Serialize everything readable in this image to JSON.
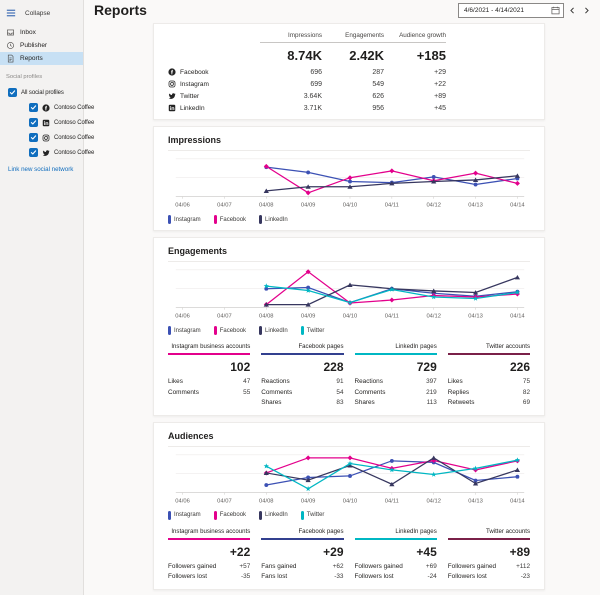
{
  "sidebar": {
    "collapse_label": "Collapse",
    "nav": [
      {
        "label": "Inbox",
        "icon": "inbox-icon",
        "key": "inbox",
        "selected": false
      },
      {
        "label": "Publisher",
        "icon": "publisher-icon",
        "key": "publisher",
        "selected": false
      },
      {
        "label": "Reports",
        "icon": "reports-icon",
        "key": "reports",
        "selected": true
      }
    ],
    "section_label": "Social profiles",
    "all_profiles_label": "All social profiles",
    "profiles": [
      {
        "network": "facebook",
        "label": "Contoso Coffee"
      },
      {
        "network": "linkedin",
        "label": "Contoso Coffee"
      },
      {
        "network": "instagram",
        "label": "Contoso Coffee"
      },
      {
        "network": "twitter",
        "label": "Contoso Coffee"
      }
    ],
    "link_label": "Link new social network"
  },
  "header": {
    "title": "Reports",
    "date_range": "4/6/2021 - 4/14/2021"
  },
  "summary": {
    "columns": [
      "Impressions",
      "Engagements",
      "Audience growth"
    ],
    "totals": [
      "8.74K",
      "2.42K",
      "+185"
    ],
    "rows": [
      {
        "network": "facebook",
        "label": "Facebook",
        "values": [
          "696",
          "287",
          "+29"
        ]
      },
      {
        "network": "instagram",
        "label": "Instagram",
        "values": [
          "699",
          "549",
          "+22"
        ]
      },
      {
        "network": "twitter",
        "label": "Twitter",
        "values": [
          "3.64K",
          "626",
          "+89"
        ]
      },
      {
        "network": "linkedin",
        "label": "LinkedIn",
        "values": [
          "3.71K",
          "956",
          "+45"
        ]
      }
    ]
  },
  "sections": {
    "impressions": {
      "title": "Impressions"
    },
    "engagements": {
      "title": "Engagements"
    },
    "audiences": {
      "title": "Audiences"
    }
  },
  "palette": {
    "instagram_line": "#3c51b4",
    "facebook_line": "#e3008c",
    "linkedin_line": "#37375f",
    "twitter_line": "#00b7c3",
    "link_blue": "#0f6cbd",
    "checkbox_blue": "#106ebe",
    "selected_nav_bg": "#c7e0f4"
  },
  "chart_data": [
    {
      "type": "line",
      "title": "Impressions",
      "x": [
        "04/06",
        "04/07",
        "04/08",
        "04/09",
        "04/10",
        "04/11",
        "04/12",
        "04/13",
        "04/14"
      ],
      "ylim": [
        0,
        100
      ],
      "grid": "horizontal",
      "legend_position": "bottom",
      "note": "values estimated 0-100 relative scale; no y-axis labels shown",
      "series": [
        {
          "name": "Instagram",
          "color": "#3c51b4",
          "marker": "circle",
          "values": [
            null,
            null,
            78,
            64,
            40,
            37,
            52,
            32,
            48
          ]
        },
        {
          "name": "Facebook",
          "color": "#e3008c",
          "marker": "diamond",
          "values": [
            null,
            null,
            80,
            10,
            50,
            68,
            42,
            62,
            35
          ]
        },
        {
          "name": "LinkedIn",
          "color": "#37375f",
          "marker": "triangle",
          "values": [
            null,
            null,
            15,
            26,
            26,
            35,
            40,
            44,
            55
          ]
        }
      ]
    },
    {
      "type": "line",
      "title": "Engagements",
      "x": [
        "04/06",
        "04/07",
        "04/08",
        "04/09",
        "04/10",
        "04/11",
        "04/12",
        "04/13",
        "04/14"
      ],
      "ylim": [
        0,
        100
      ],
      "grid": "horizontal",
      "legend_position": "bottom",
      "note": "values estimated 0-100 relative scale; no y-axis labels shown",
      "series": [
        {
          "name": "Instagram",
          "color": "#3c51b4",
          "marker": "circle",
          "values": [
            null,
            null,
            50,
            53,
            13,
            50,
            38,
            30,
            42
          ]
        },
        {
          "name": "Facebook",
          "color": "#e3008c",
          "marker": "diamond",
          "values": [
            null,
            null,
            8,
            95,
            12,
            20,
            32,
            28,
            36
          ]
        },
        {
          "name": "LinkedIn",
          "color": "#37375f",
          "marker": "triangle",
          "values": [
            null,
            null,
            8,
            8,
            60,
            50,
            44,
            40,
            80
          ]
        },
        {
          "name": "Twitter",
          "color": "#00b7c3",
          "marker": "star",
          "values": [
            null,
            null,
            57,
            45,
            13,
            48,
            28,
            24,
            40
          ]
        }
      ]
    },
    {
      "type": "line",
      "title": "Audiences",
      "x": [
        "04/06",
        "04/07",
        "04/08",
        "04/09",
        "04/10",
        "04/11",
        "04/12",
        "04/13",
        "04/14"
      ],
      "ylim": [
        0,
        100
      ],
      "grid": "horizontal",
      "legend_position": "bottom",
      "note": "values estimated 0-100 relative scale; no y-axis labels shown",
      "series": [
        {
          "name": "Instagram",
          "color": "#3c51b4",
          "marker": "circle",
          "values": [
            null,
            null,
            20,
            40,
            44,
            84,
            80,
            32,
            42
          ]
        },
        {
          "name": "Facebook",
          "color": "#e3008c",
          "marker": "diamond",
          "values": [
            null,
            null,
            52,
            92,
            92,
            64,
            85,
            60,
            84
          ]
        },
        {
          "name": "LinkedIn",
          "color": "#37375f",
          "marker": "triangle",
          "values": [
            null,
            null,
            52,
            33,
            72,
            22,
            92,
            24,
            60
          ]
        },
        {
          "name": "Twitter",
          "color": "#00b7c3",
          "marker": "star",
          "values": [
            null,
            null,
            70,
            10,
            77,
            60,
            48,
            64,
            86
          ]
        }
      ]
    }
  ],
  "stats": {
    "engagements": {
      "columns": [
        {
          "header": "Instagram business accounts",
          "accent": "#e3008c",
          "total": "102",
          "rows": [
            [
              "Likes",
              "47"
            ],
            [
              "Comments",
              "55"
            ]
          ]
        },
        {
          "header": "Facebook pages",
          "accent": "#32408f",
          "total": "228",
          "rows": [
            [
              "Reactions",
              "91"
            ],
            [
              "Comments",
              "54"
            ],
            [
              "Shares",
              "83"
            ]
          ]
        },
        {
          "header": "LinkedIn pages",
          "accent": "#00b7c3",
          "total": "729",
          "rows": [
            [
              "Reactions",
              "397"
            ],
            [
              "Comments",
              "219"
            ],
            [
              "Shares",
              "113"
            ]
          ]
        },
        {
          "header": "Twitter accounts",
          "accent": "#7a2048",
          "total": "226",
          "rows": [
            [
              "Likes",
              "75"
            ],
            [
              "Replies",
              "82"
            ],
            [
              "Retweets",
              "69"
            ]
          ]
        }
      ]
    },
    "audiences": {
      "columns": [
        {
          "header": "Instagram business accounts",
          "accent": "#e3008c",
          "total": "+22",
          "rows": [
            [
              "Followers gained",
              "+57"
            ],
            [
              "Followers lost",
              "-35"
            ]
          ]
        },
        {
          "header": "Facebook pages",
          "accent": "#32408f",
          "total": "+29",
          "rows": [
            [
              "Fans gained",
              "+62"
            ],
            [
              "Fans lost",
              "-33"
            ]
          ]
        },
        {
          "header": "LinkedIn pages",
          "accent": "#00b7c3",
          "total": "+45",
          "rows": [
            [
              "Followers gained",
              "+69"
            ],
            [
              "Followers lost",
              "-24"
            ]
          ]
        },
        {
          "header": "Twitter accounts",
          "accent": "#7a2048",
          "total": "+89",
          "rows": [
            [
              "Followers gained",
              "+112"
            ],
            [
              "Followers lost",
              "-23"
            ]
          ]
        }
      ]
    }
  }
}
